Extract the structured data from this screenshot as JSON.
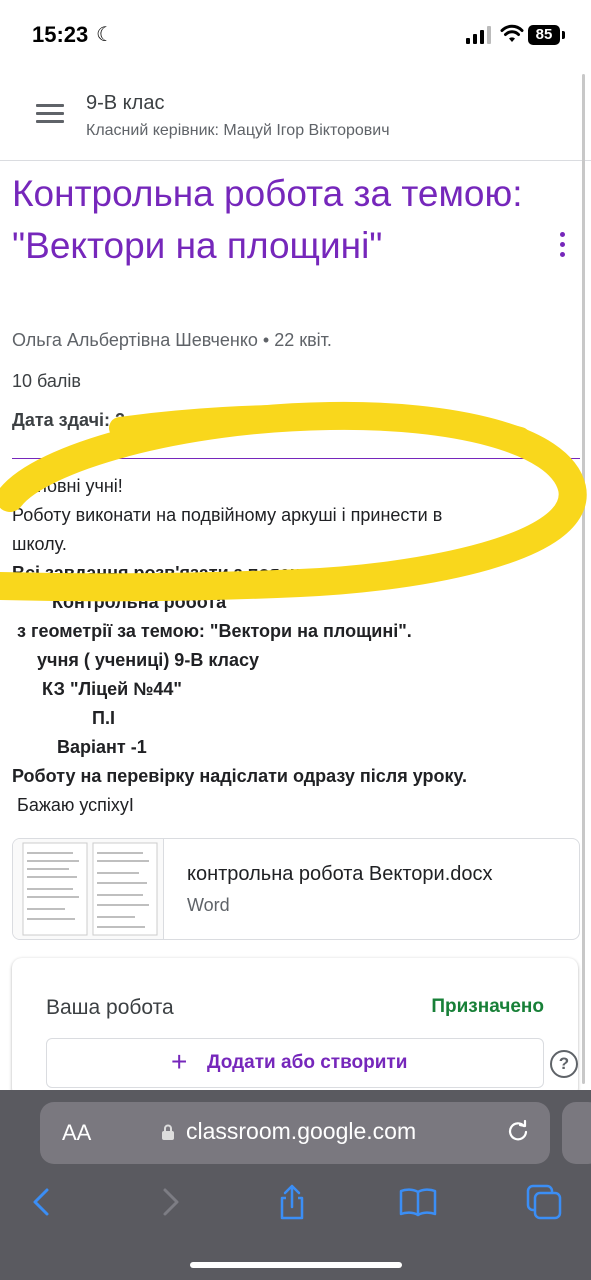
{
  "status_bar": {
    "time": "15:23",
    "battery": "85"
  },
  "header": {
    "class_name": "9-В клас",
    "teacher": "Класний керівник: Мацуй Ігор Вікторович"
  },
  "assignment": {
    "title": "Контрольна робота за темою: \"Вектори на площині\"",
    "author_line": "Ольга Альбертівна Шевченко • 22 квіт.",
    "points": "10 балів",
    "due": "Дата здачі: 2...",
    "description": [
      "...ановні учні!",
      "Роботу виконати на подвійному аркуші і принести в",
      "школу.",
      "Всі завдання розв'язати з поясненнями.",
      "        Контрольна робота",
      " з геометрії за темою: \"Вектори на площині\".",
      "     учня ( учениці) 9-В класу",
      "      КЗ \"Ліцей №44\"",
      "                П.І",
      "         Варіант -1",
      "Роботу на перевірку надіслати одразу після уроку.",
      " Бажаю успіхуI"
    ]
  },
  "attachment": {
    "name": "контрольна робота Вектори.docx",
    "type": "Word"
  },
  "your_work": {
    "title": "Ваша робота",
    "status": "Призначено",
    "add_label": "Додати або створити"
  },
  "browser": {
    "aa": "AA",
    "url": "classroom.google.com"
  },
  "colors": {
    "accent": "#7627bb",
    "status_green": "#188038",
    "highlighter": "#f9d71c"
  }
}
